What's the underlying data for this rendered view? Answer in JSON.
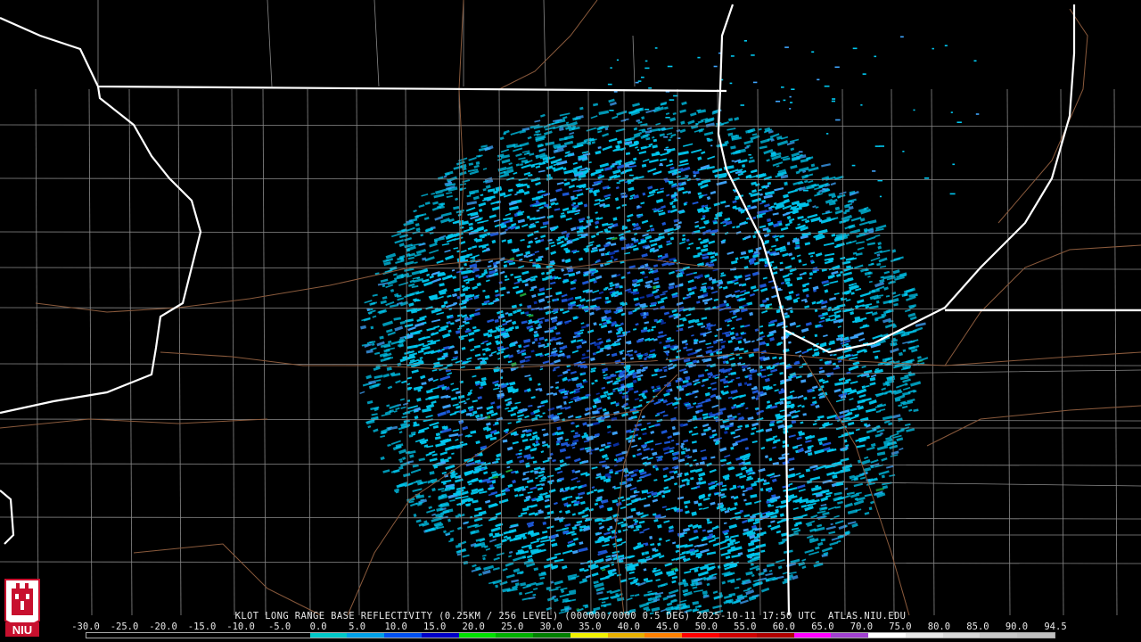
{
  "product": {
    "caption": "KLOT LONG RANGE BASE REFLECTIVITY (0.25KM / 256 LEVEL) (000000/0000 0.5 DEG) 2025-10-11 17:50 UTC  ATLAS.NIU.EDU",
    "station": "KLOT",
    "product_name": "LONG RANGE BASE REFLECTIVITY",
    "resolution": "0.25KM / 256 LEVEL",
    "elevation": "0.5 DEG",
    "timestamp": "2025-10-11 17:50 UTC",
    "source": "ATLAS.NIU.EDU"
  },
  "scale": {
    "labels": [
      "-30.0",
      "-25.0",
      "-20.0",
      "-15.0",
      "-10.0",
      "-5.0",
      "0.0",
      "5.0",
      "10.0",
      "15.0",
      "20.0",
      "25.0",
      "30.0",
      "35.0",
      "40.0",
      "45.0",
      "50.0",
      "55.0",
      "60.0",
      "65.0",
      "70.0",
      "75.0",
      "80.0",
      "85.0",
      "90.0",
      "94.5"
    ],
    "colors": [
      "#000000",
      "#000000",
      "#000000",
      "#000000",
      "#000000",
      "#000000",
      "#00c8c8",
      "#00a0e8",
      "#0050f0",
      "#0000c8",
      "#00e000",
      "#00b000",
      "#008000",
      "#f0f000",
      "#e8b000",
      "#ff8000",
      "#ff0000",
      "#d00000",
      "#b00000",
      "#ff00ff",
      "#a040d0",
      "#ffffff",
      "#e8e8e8",
      "#d8d8d8",
      "#c8c8c8",
      "#c0c0c0"
    ]
  },
  "radar": {
    "colors": {
      "light": "#00c8f0",
      "mid": "#3fa6ff",
      "deep": "#1e5adc",
      "dark": "#0a2fa8",
      "green": "#1fa83c"
    }
  },
  "map_colors": {
    "state_border": "#ffffff",
    "county_border": "#8a8a8a",
    "highway": "#8a5a3c",
    "water": "#000000"
  },
  "logo": {
    "text": "NIU",
    "color": "#c8102e"
  }
}
